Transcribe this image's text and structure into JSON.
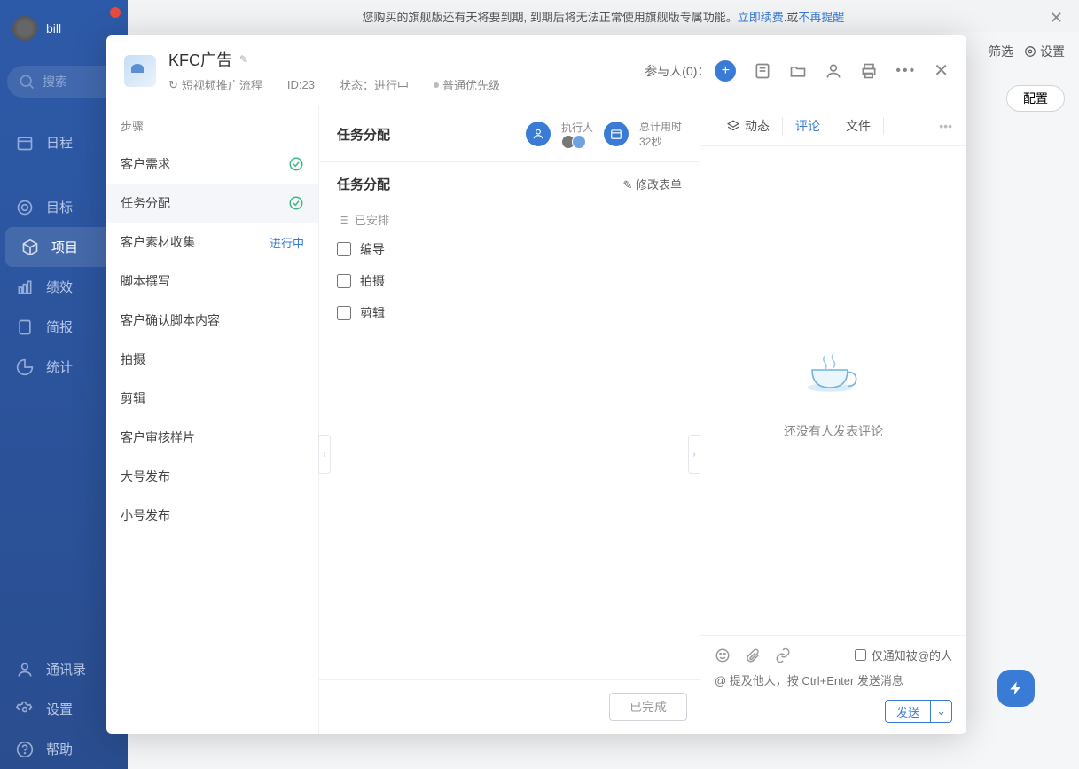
{
  "user": {
    "name": "bill"
  },
  "search": {
    "placeholder": "搜索"
  },
  "nav": {
    "schedule": "日程",
    "goal": "目标",
    "project": "项目",
    "performance": "绩效",
    "brief": "简报",
    "stats": "统计",
    "contacts": "通讯录",
    "settings": "设置",
    "help": "帮助"
  },
  "banner": {
    "text": "您购买的旗舰版还有天将要到期, 到期后将无法正常使用旗舰版专属功能。",
    "renew": "立即续费",
    "or": ".或",
    "dismiss": "不再提醒"
  },
  "page_tools": {
    "filter": "筛选",
    "settings": "设置",
    "config": "配置"
  },
  "modal": {
    "title": "KFC广告",
    "flow": "短视频推广流程",
    "id_label": "ID:23",
    "status": "状态：进行中",
    "priority": "普通优先级",
    "participants_label": "参与人(0)："
  },
  "steps_header": "步骤",
  "steps": [
    {
      "name": "客户需求",
      "state": "done"
    },
    {
      "name": "任务分配",
      "state": "done",
      "active": true
    },
    {
      "name": "客户素材收集",
      "state": "inprogress",
      "status_text": "进行中"
    },
    {
      "name": "脚本撰写",
      "state": ""
    },
    {
      "name": "客户确认脚本内容",
      "state": ""
    },
    {
      "name": "拍摄",
      "state": ""
    },
    {
      "name": "剪辑",
      "state": ""
    },
    {
      "name": "客户审核样片",
      "state": ""
    },
    {
      "name": "大号发布",
      "state": ""
    },
    {
      "name": "小号发布",
      "state": ""
    }
  ],
  "center": {
    "title": "任务分配",
    "exec_label": "执行人",
    "time_label": "总计用时",
    "time_value": "32秒",
    "section_title": "任务分配",
    "modify": "修改表单",
    "arranged": "已安排",
    "tasks": [
      "编导",
      "拍摄",
      "剪辑"
    ],
    "done_btn": "已完成"
  },
  "right": {
    "tabs": {
      "activity": "动态",
      "comment": "评论",
      "file": "文件"
    },
    "empty": "还没有人发表评论",
    "only_at": "仅通知被@的人",
    "placeholder": "@ 提及他人，按 Ctrl+Enter 发送消息",
    "send": "发送"
  }
}
